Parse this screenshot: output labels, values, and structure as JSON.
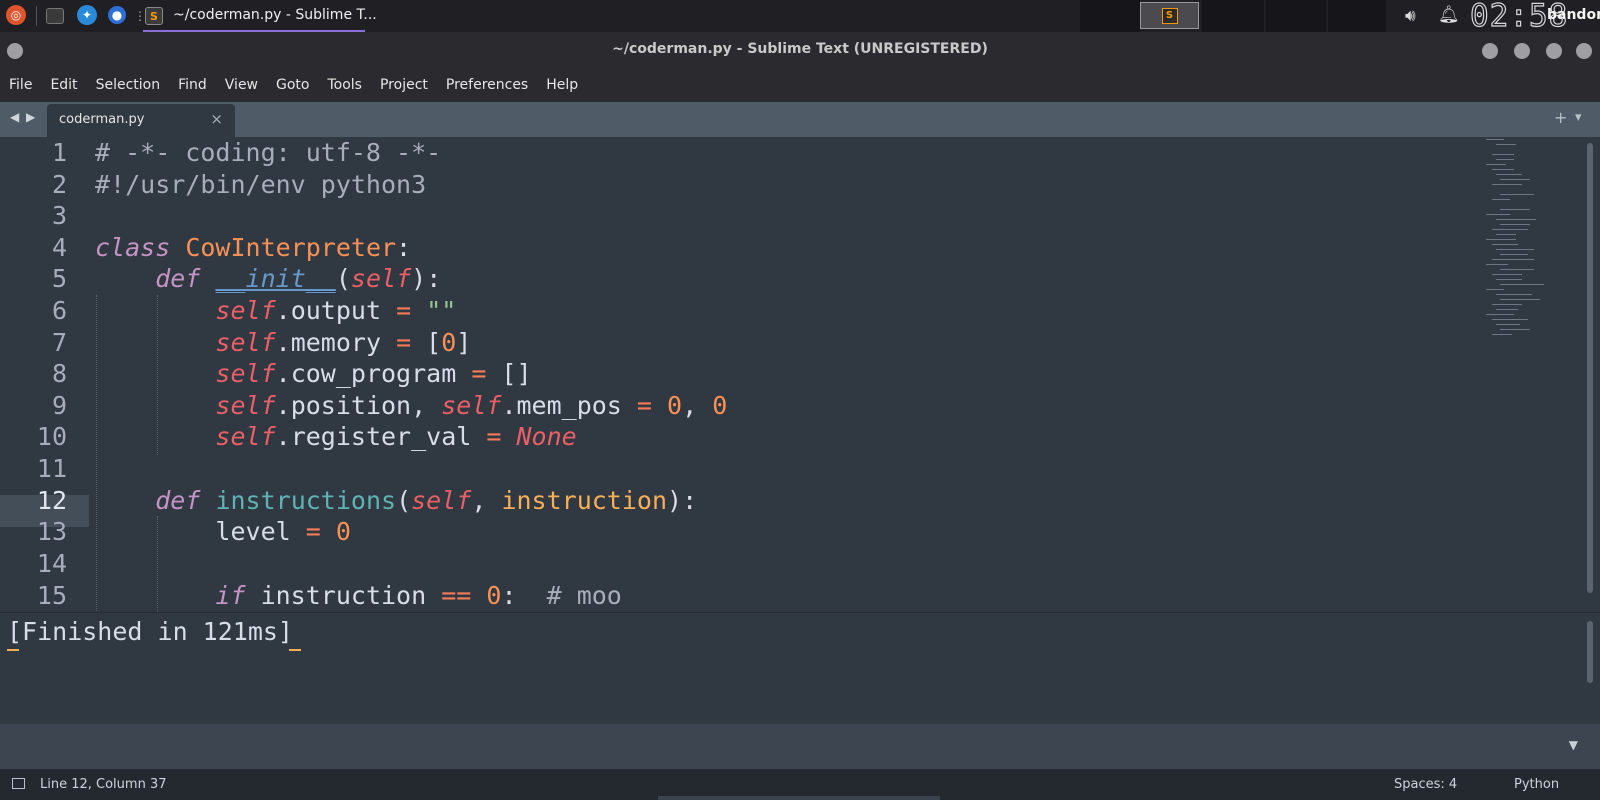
{
  "taskbar": {
    "icons": [
      "ubuntu-logo-icon",
      "terminal-icon",
      "browser-icon",
      "chromium-icon",
      "sublime-text-icon"
    ],
    "active_window_label": "~/coderman.py - Sublime T...",
    "clock": "02:58",
    "username": "bandor",
    "tray_icons": [
      "volume-icon",
      "bell-icon"
    ]
  },
  "window": {
    "title": "~/coderman.py - Sublime Text (UNREGISTERED)"
  },
  "menu": [
    "File",
    "Edit",
    "Selection",
    "Find",
    "View",
    "Goto",
    "Tools",
    "Project",
    "Preferences",
    "Help"
  ],
  "tabs": [
    {
      "label": "coderman.py",
      "close": "×"
    }
  ],
  "tab_controls": {
    "prev": "◀",
    "next": "▶",
    "add": "+",
    "more": "▾"
  },
  "editor": {
    "current_line": 12,
    "line_numbers": [
      "1",
      "2",
      "3",
      "4",
      "5",
      "6",
      "7",
      "8",
      "9",
      "10",
      "11",
      "12",
      "13",
      "14",
      "15"
    ]
  },
  "output": {
    "text": "[Finished in 121ms]"
  },
  "status": {
    "position": "Line 12, Column 37",
    "indentation": "Spaces: 4",
    "syntax": "Python"
  },
  "colors": {
    "editor_bg": "#303841",
    "keyword": "#c594c5",
    "class_name": "#f99157",
    "function": "#5fb3b3",
    "self": "#ec5f67",
    "string": "#99c794",
    "operator": "#f97b58"
  }
}
